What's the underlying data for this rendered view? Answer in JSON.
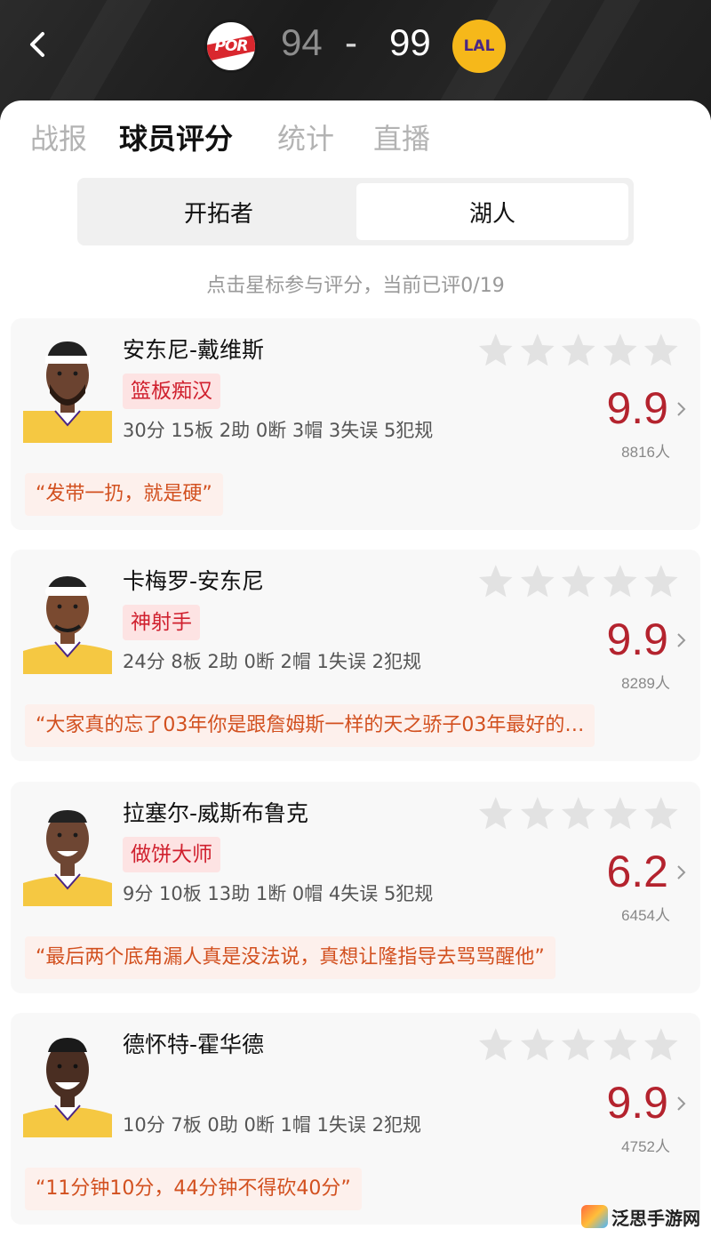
{
  "header": {
    "home_team_logo": "POR",
    "home_score": "94",
    "separator": "-",
    "away_score": "99",
    "away_team_logo": "LAL"
  },
  "tabs": [
    {
      "label": "战报",
      "active": false
    },
    {
      "label": "球员评分",
      "active": true
    },
    {
      "label": "统计",
      "active": false
    },
    {
      "label": "直播",
      "active": false
    }
  ],
  "team_switch": {
    "left": "开拓者",
    "right": "湖人",
    "selected": "湖人"
  },
  "hint": "点击星标参与评分，当前已评0/19",
  "players": [
    {
      "name": "安东尼-戴维斯",
      "tag": "篮板痴汉",
      "stats": "30分 15板 2助 0断 3帽 3失误 5犯规",
      "rating": "9.9",
      "count": "8816人",
      "comment": "“发带一扔，就是硬”"
    },
    {
      "name": "卡梅罗-安东尼",
      "tag": "神射手",
      "stats": "24分 8板 2助 0断 2帽 1失误 2犯规",
      "rating": "9.9",
      "count": "8289人",
      "comment": "“大家真的忘了03年你是跟詹姆斯一样的天之骄子03年最好的…"
    },
    {
      "name": "拉塞尔-威斯布鲁克",
      "tag": "做饼大师",
      "stats": "9分 10板 13助 1断 0帽 4失误 5犯规",
      "rating": "6.2",
      "count": "6454人",
      "comment": "“最后两个底角漏人真是没法说，真想让隆指导去骂骂醒他”"
    },
    {
      "name": "德怀特-霍华德",
      "tag": "",
      "stats": "10分 7板 0助 0断 1帽 1失误 2犯规",
      "rating": "9.9",
      "count": "4752人",
      "comment": "“11分钟10分，44分钟不得砍40分”"
    }
  ],
  "watermark": "泛思手游网",
  "colors": {
    "accent": "#c8202f",
    "rating": "#b4232e",
    "tag_bg": "#fde3e3",
    "comment_text": "#d2501f",
    "lakers_gold": "#f6b81a"
  }
}
